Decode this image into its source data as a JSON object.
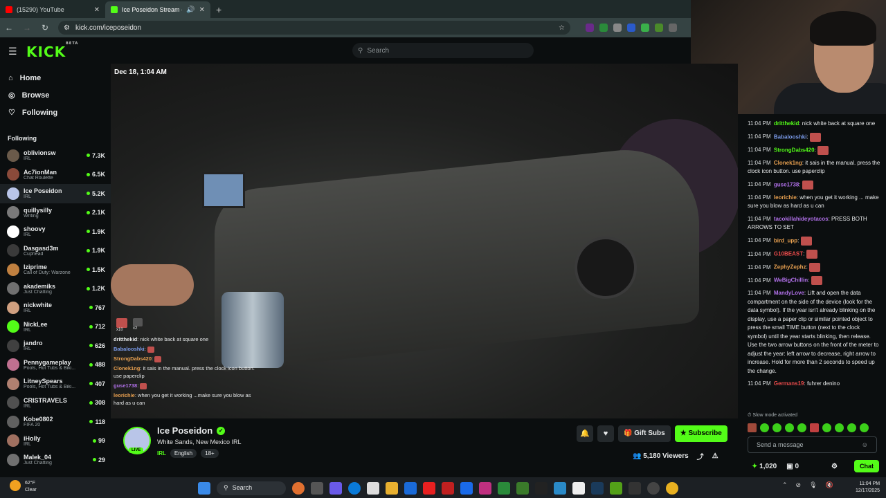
{
  "browser": {
    "tabs": [
      {
        "label": "(15290) YouTube",
        "color": "#ff0000"
      },
      {
        "label": "Ice Poseidon Stream - Watc",
        "color": "#53fc18"
      }
    ],
    "url": "kick.com/iceposeidon"
  },
  "site": {
    "logo": "KICK",
    "logo_badge": "BETA",
    "search_placeholder": "Search",
    "nav": [
      {
        "icon": "home-icon",
        "label": "Home"
      },
      {
        "icon": "compass-icon",
        "label": "Browse"
      },
      {
        "icon": "heart-icon",
        "label": "Following"
      }
    ],
    "following_header": "Following",
    "channels": [
      {
        "name": "oblivionsw",
        "cat": "IRL",
        "viewers": "7.3K",
        "color": "#6a5a4a"
      },
      {
        "name": "Ac7ionMan",
        "cat": "Chat Roulette",
        "viewers": "6.5K",
        "color": "#8a4a3a"
      },
      {
        "name": "Ice Poseidon",
        "cat": "IRL",
        "viewers": "5.2K",
        "color": "#b9c5e8"
      },
      {
        "name": "quillysilly",
        "cat": "Writing",
        "viewers": "2.1K",
        "color": "#7a7a7a"
      },
      {
        "name": "shoovy",
        "cat": "IRL",
        "viewers": "1.9K",
        "color": "#ffffff"
      },
      {
        "name": "Dasgasd3m",
        "cat": "Cuphead",
        "viewers": "1.9K",
        "color": "#3a3a3a"
      },
      {
        "name": "lziprime",
        "cat": "Call of Duty: Warzone",
        "viewers": "1.5K",
        "color": "#c08040"
      },
      {
        "name": "akademiks",
        "cat": "Just Chatting",
        "viewers": "1.2K",
        "color": "#707070"
      },
      {
        "name": "nickwhite",
        "cat": "IRL",
        "viewers": "767",
        "color": "#d0a080"
      },
      {
        "name": "NickLee",
        "cat": "IRL",
        "viewers": "712",
        "color": "#53fc18"
      },
      {
        "name": "jandro",
        "cat": "IRL",
        "viewers": "626",
        "color": "#404040"
      },
      {
        "name": "Pennygameplay",
        "cat": "Pools, Hot Tubs & Biki...",
        "viewers": "488",
        "color": "#c07090"
      },
      {
        "name": "LitneySpears",
        "cat": "Pools, Hot Tubs & Biki...",
        "viewers": "407",
        "color": "#b08070"
      },
      {
        "name": "CRISTRAVELS",
        "cat": "IRL",
        "viewers": "308",
        "color": "#505050"
      },
      {
        "name": "Kobe0802",
        "cat": "FIFA 20",
        "viewers": "118",
        "color": "#606060"
      },
      {
        "name": "iHolly",
        "cat": "IRL",
        "viewers": "99",
        "color": "#a07060"
      },
      {
        "name": "Malek_04",
        "cat": "Just Chatting",
        "viewers": "29",
        "color": "#707070"
      }
    ]
  },
  "video": {
    "timestamp": "Dec 18, 1:04 AM",
    "emote_counts": [
      "x10",
      "x2"
    ],
    "overlay_chat": [
      {
        "user": "dritthekid",
        "color": "#e8eaeb",
        "text": "nick white back at square one"
      },
      {
        "user": "Babalooshki",
        "color": "#7a9ae8",
        "text": ""
      },
      {
        "user": "StrongDabs420",
        "color": "#e8a050",
        "text": ""
      },
      {
        "user": "Clonek1ng",
        "color": "#e8a050",
        "text": "it sais in the manual. press the clock icon button. use paperclip"
      },
      {
        "user": "guse1738",
        "color": "#b070e8",
        "text": ""
      },
      {
        "user": "leorichie",
        "color": "#e8a050",
        "text": "when you get it working ...make sure you blow as hard as u can"
      }
    ]
  },
  "stream": {
    "streamer": "Ice Poseidon",
    "live_badge": "LIVE",
    "title": "White Sands, New Mexico IRL",
    "category": "IRL",
    "tags": [
      "English",
      "18+"
    ],
    "gift_label": "Gift Subs",
    "subscribe_label": "Subscribe",
    "viewers": "5,180 Viewers"
  },
  "chat": {
    "messages": [
      {
        "time": "11:04 PM",
        "user": "dritthekid",
        "color": "#53fc18",
        "text": "nick white back at square one"
      },
      {
        "time": "11:04 PM",
        "user": "Babalooshki",
        "color": "#7a9ae8",
        "text": ""
      },
      {
        "time": "11:04 PM",
        "user": "StrongDabs420",
        "color": "#53fc18",
        "text": ""
      },
      {
        "time": "11:04 PM",
        "user": "Clonek1ng",
        "color": "#e8a050",
        "text": "it sais in the manual. press the clock icon button. use paperclip"
      },
      {
        "time": "11:04 PM",
        "user": "guse1738",
        "color": "#b070e8",
        "text": ""
      },
      {
        "time": "11:04 PM",
        "user": "leorichie",
        "color": "#e8a050",
        "text": "when you get it working ... make sure you blow as hard as u can"
      },
      {
        "time": "11:04 PM",
        "user": "tacokillahideyotacos",
        "color": "#b070e8",
        "text": "PRESS BOTH ARROWS TO SET"
      },
      {
        "time": "11:04 PM",
        "user": "bird_upp",
        "color": "#e8a050",
        "text": ""
      },
      {
        "time": "11:04 PM",
        "user": "G10BEAST",
        "color": "#e84a4a",
        "text": ""
      },
      {
        "time": "11:04 PM",
        "user": "ZephyZephz",
        "color": "#e8a050",
        "text": ""
      },
      {
        "time": "11:04 PM",
        "user": "WeBigChillin",
        "color": "#b070e8",
        "text": ""
      },
      {
        "time": "11:04 PM",
        "user": "MandyLove",
        "color": "#b070e8",
        "text": "Lift and open the data compartment on the side of the device (look for the data symbol). If the year isn't already blinking on the display, use a paper clip or similar pointed object to press the small TIME button (next to the clock symbol) until the year starts blinking, then release. Use the two arrow buttons on the front of the meter to adjust the year: left arrow to decrease, right arrow to increase. Hold for more than 2 seconds to speed up the change."
      },
      {
        "time": "11:04 PM",
        "user": "Germans19",
        "color": "#e84a4a",
        "text": "fuhrer denino"
      }
    ],
    "slow_mode": "Slow mode activated",
    "input_placeholder": "Send a message",
    "kick_points": "1,020",
    "gift_count": "0",
    "chat_button": "Chat"
  },
  "taskbar": {
    "temp": "62°F",
    "weather": "Clear",
    "search": "Search",
    "time": "11:04 PM",
    "date": "12/17/2025"
  }
}
